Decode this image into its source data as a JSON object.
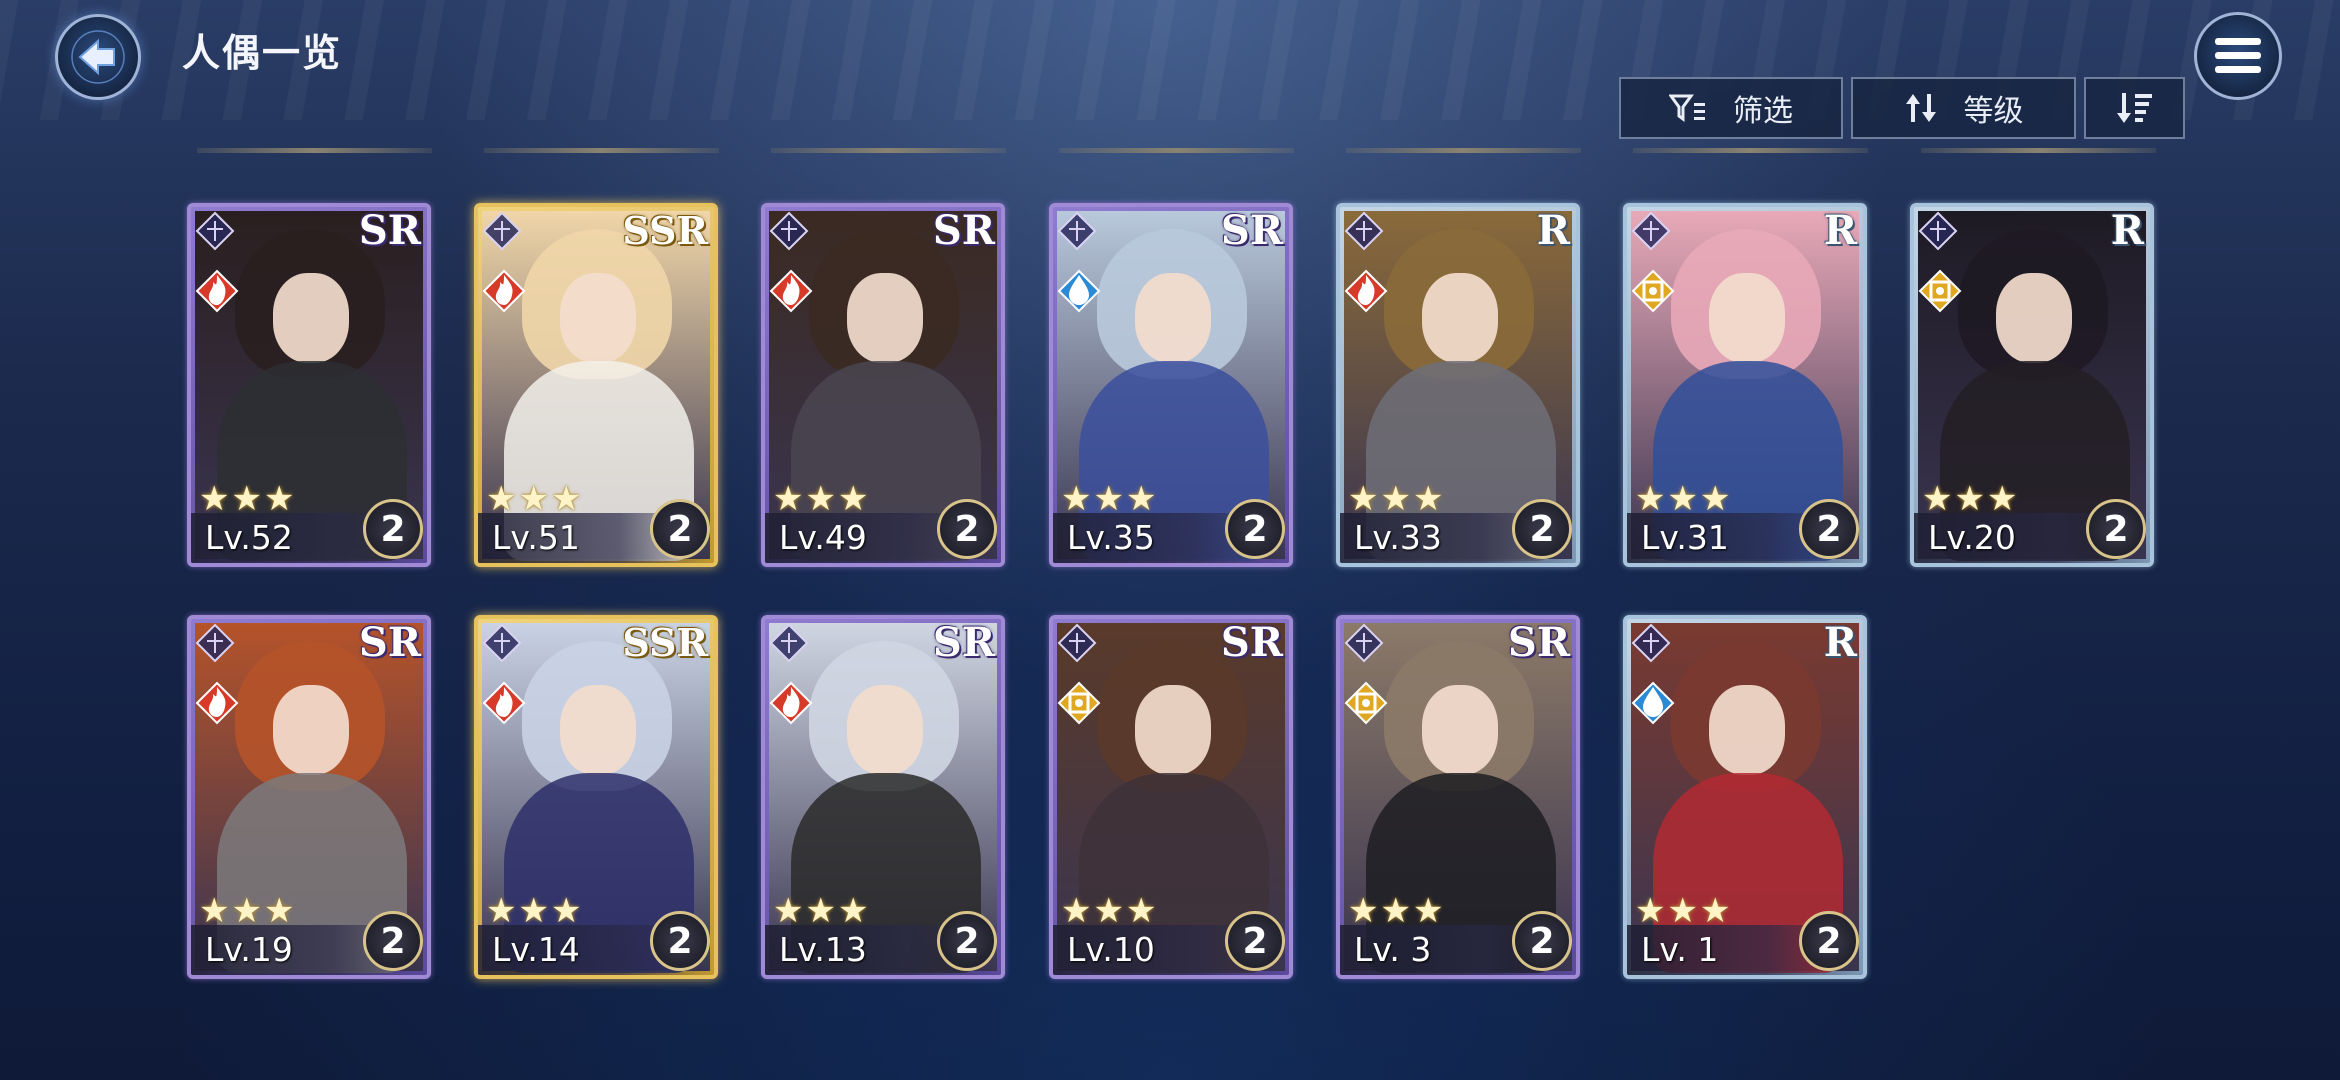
{
  "header": {
    "title": "人偶一览"
  },
  "toolbar": {
    "filter_label": "筛选",
    "sort_label": "等级"
  },
  "colors": {
    "sr_frame": "#a08ad6",
    "ssr_frame": "#e6c15c",
    "r_frame": "#a8c4dc",
    "fire": "#d83a2a",
    "water": "#2b8ad6",
    "light": "#e0a820"
  },
  "cards": [
    {
      "rarity": "SR",
      "element": "fire",
      "level": "Lv.52",
      "stars": "★★★",
      "badge": "2"
    },
    {
      "rarity": "SSR",
      "element": "fire",
      "level": "Lv.51",
      "stars": "★★★",
      "badge": "2"
    },
    {
      "rarity": "SR",
      "element": "fire",
      "level": "Lv.49",
      "stars": "★★★",
      "badge": "2"
    },
    {
      "rarity": "SR",
      "element": "water",
      "level": "Lv.35",
      "stars": "★★★",
      "badge": "2"
    },
    {
      "rarity": "R",
      "element": "fire",
      "level": "Lv.33",
      "stars": "★★★",
      "badge": "2"
    },
    {
      "rarity": "R",
      "element": "light",
      "level": "Lv.31",
      "stars": "★★★",
      "badge": "2"
    },
    {
      "rarity": "R",
      "element": "light",
      "level": "Lv.20",
      "stars": "★★★",
      "badge": "2"
    },
    {
      "rarity": "SR",
      "element": "fire",
      "level": "Lv.19",
      "stars": "★★★",
      "badge": "2"
    },
    {
      "rarity": "SSR",
      "element": "fire",
      "level": "Lv.14",
      "stars": "★★★",
      "badge": "2"
    },
    {
      "rarity": "SR",
      "element": "fire",
      "level": "Lv.13",
      "stars": "★★★",
      "badge": "2"
    },
    {
      "rarity": "SR",
      "element": "light",
      "level": "Lv.10",
      "stars": "★★★",
      "badge": "2"
    },
    {
      "rarity": "SR",
      "element": "light",
      "level": "Lv. 3",
      "stars": "★★★",
      "badge": "2"
    },
    {
      "rarity": "R",
      "element": "water",
      "level": "Lv. 1",
      "stars": "★★★",
      "badge": "2"
    }
  ]
}
